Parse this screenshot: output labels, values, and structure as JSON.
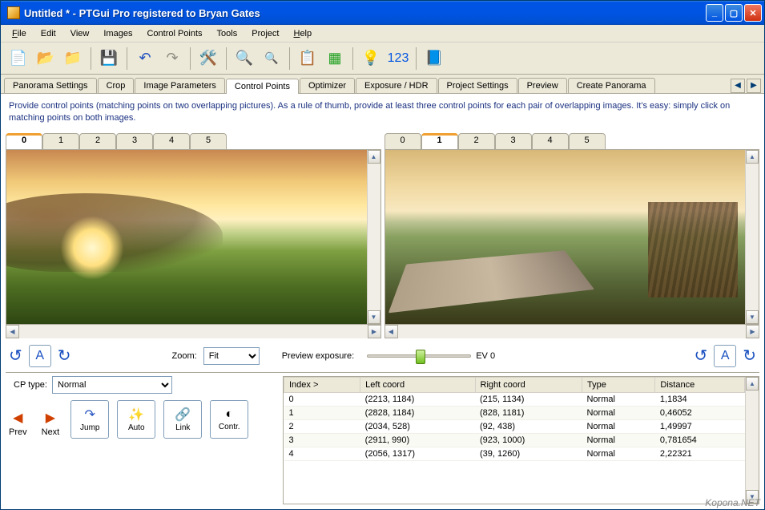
{
  "titlebar": {
    "text": "Untitled * - PTGui Pro registered to Bryan Gates"
  },
  "menu": {
    "file": "File",
    "edit": "Edit",
    "view": "View",
    "images": "Images",
    "controlpoints": "Control Points",
    "tools": "Tools",
    "project": "Project",
    "help": "Help"
  },
  "toolbar": {
    "number_text": "123"
  },
  "tabs": {
    "items": [
      "Panorama Settings",
      "Crop",
      "Image Parameters",
      "Control Points",
      "Optimizer",
      "Exposure / HDR",
      "Project Settings",
      "Preview",
      "Create Panorama"
    ],
    "active_index": 3
  },
  "help_text": "Provide control points (matching points on two overlapping pictures). As a rule of thumb, provide at least three control points for each pair of overlapping images. It's easy: simply click on matching points on both images.",
  "image_tabs": {
    "left": {
      "items": [
        "0",
        "1",
        "2",
        "3",
        "4",
        "5"
      ],
      "active": 0
    },
    "right": {
      "items": [
        "0",
        "1",
        "2",
        "3",
        "4",
        "5"
      ],
      "active": 1
    }
  },
  "controls": {
    "a_button": "A",
    "zoom_label": "Zoom:",
    "zoom_value": "Fit",
    "preview_exposure_label": "Preview exposure:",
    "ev_label": "EV 0"
  },
  "cp": {
    "cp_type_label": "CP type:",
    "cp_type_value": "Normal",
    "prev": "Prev",
    "next": "Next",
    "jump": "Jump",
    "auto": "Auto",
    "link": "Link",
    "contr": "Contr."
  },
  "table": {
    "headers": [
      "Index >",
      "Left coord",
      "Right coord",
      "Type",
      "Distance"
    ],
    "rows": [
      {
        "index": "0",
        "left": "(2213, 1184)",
        "right": "(215, 1134)",
        "type": "Normal",
        "dist": "1,1834"
      },
      {
        "index": "1",
        "left": "(2828, 1184)",
        "right": "(828, 1181)",
        "type": "Normal",
        "dist": "0,46052"
      },
      {
        "index": "2",
        "left": "(2034, 528)",
        "right": "(92, 438)",
        "type": "Normal",
        "dist": "1,49997"
      },
      {
        "index": "3",
        "left": "(2911, 990)",
        "right": "(923, 1000)",
        "type": "Normal",
        "dist": "0,781654"
      },
      {
        "index": "4",
        "left": "(2056, 1317)",
        "right": "(39, 1260)",
        "type": "Normal",
        "dist": "2,22321"
      }
    ]
  },
  "watermark": "Kopona.NET"
}
